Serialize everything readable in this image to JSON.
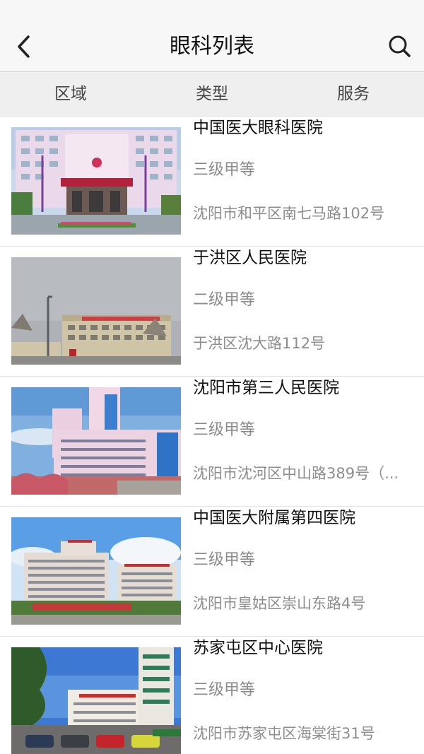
{
  "header": {
    "title": "眼科列表",
    "back_icon": "back-chevron-icon",
    "search_icon": "search-icon"
  },
  "filters": [
    {
      "label": "区域"
    },
    {
      "label": "类型"
    },
    {
      "label": "服务"
    }
  ],
  "hospitals": [
    {
      "name": "中国医大眼科医院",
      "level": "三级甲等",
      "address": "沈阳市和平区南七马路102号"
    },
    {
      "name": "于洪区人民医院",
      "level": "二级甲等",
      "address": "于洪区沈大路112号"
    },
    {
      "name": "沈阳市第三人民医院",
      "level": "三级甲等",
      "address": "沈阳市沈河区中山路389号（..."
    },
    {
      "name": "中国医大附属第四医院",
      "level": "三级甲等",
      "address": "沈阳市皇姑区崇山东路4号"
    },
    {
      "name": "苏家屯区中心医院",
      "level": "三级甲等",
      "address": "沈阳市苏家屯区海棠街31号"
    }
  ]
}
